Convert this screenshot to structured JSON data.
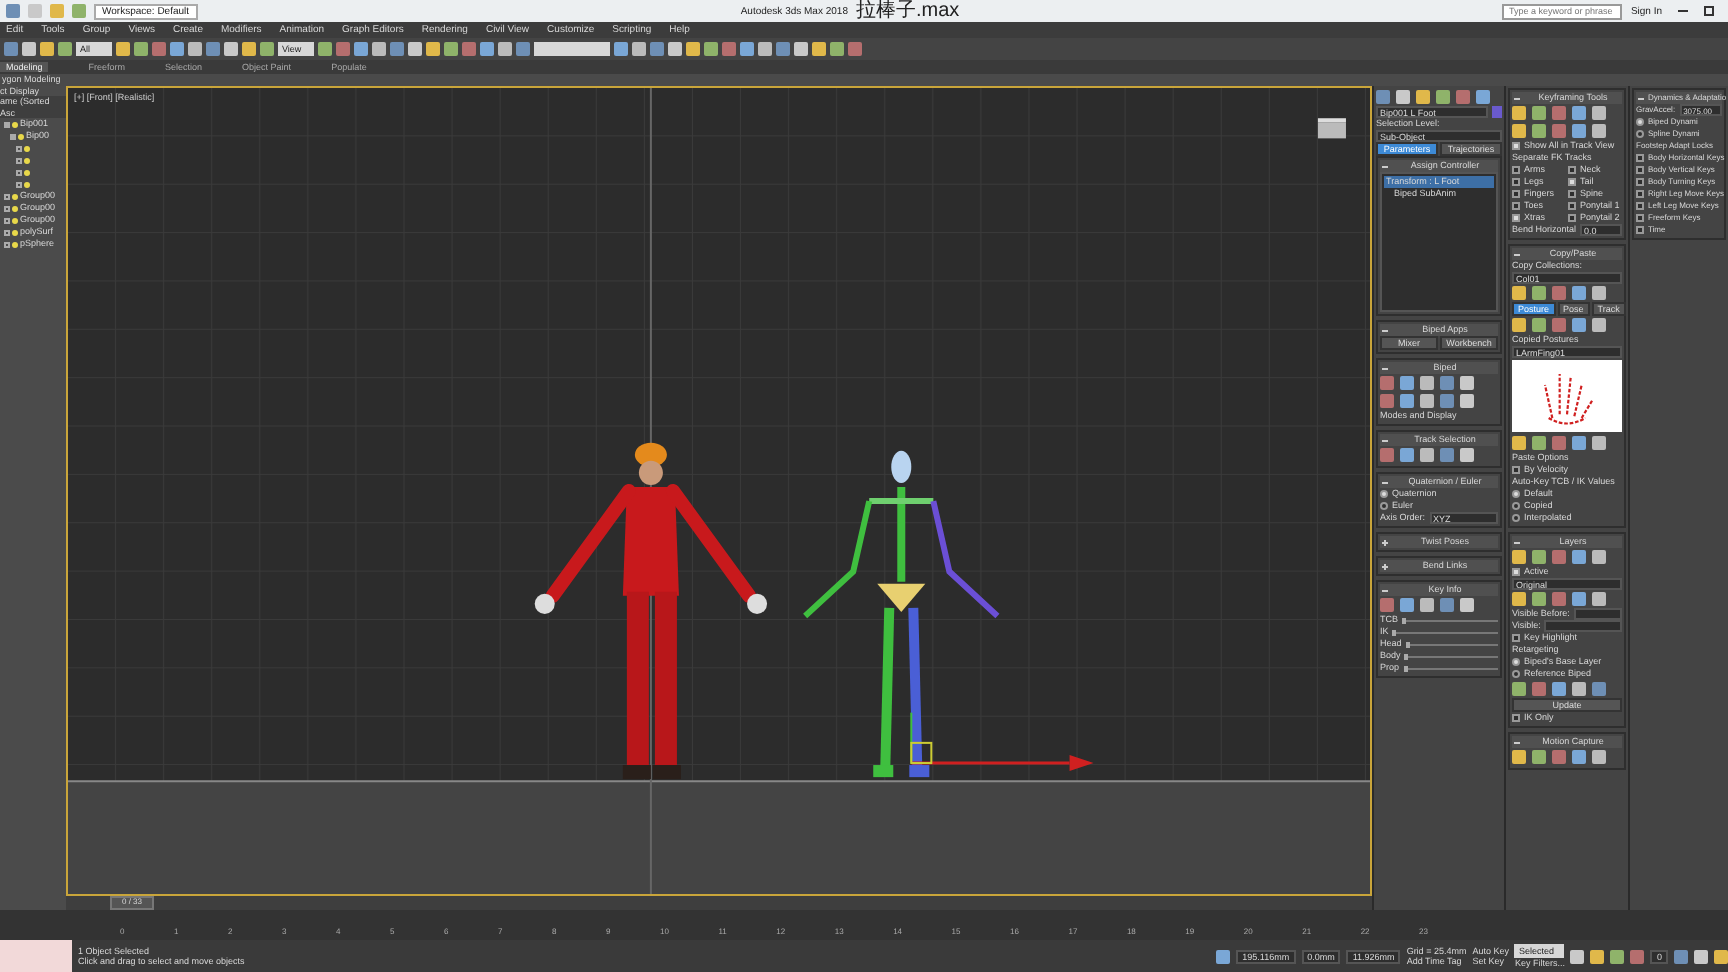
{
  "title_bar": {
    "workspace": "Workspace: Default",
    "title": "Autodesk 3ds Max 2018",
    "file": "拉棒子.max",
    "search": {
      "placeholder": "Type a keyword or phrase"
    },
    "sign_in": "Sign In"
  },
  "menu": [
    "Edit",
    "Tools",
    "Group",
    "Views",
    "Create",
    "Modifiers",
    "Animation",
    "Graph Editors",
    "Rendering",
    "Civil View",
    "Customize",
    "Scripting",
    "Help"
  ],
  "toolbar": {
    "selection_filter": "All",
    "reference_coordinate": "View"
  },
  "ribbon_tabs": [
    {
      "label": "Modeling",
      "selected": true
    },
    {
      "label": "Freeform",
      "selected": false
    },
    {
      "label": "Selection",
      "selected": false
    },
    {
      "label": "Object Paint",
      "selected": false
    },
    {
      "label": "Populate",
      "selected": false
    }
  ],
  "ribbon_panel": "ygon Modeling",
  "explorer": {
    "tabs": [
      "ct",
      "Display"
    ],
    "header": "ame (Sorted Asc",
    "items": [
      {
        "label": "Bip001",
        "expanded": true,
        "children": [
          {
            "label": "Bip00",
            "expanded": true,
            "children": [
              {
                "expanded": false
              },
              {
                "expanded": false
              },
              {
                "expanded": false
              },
              {
                "expanded": false
              }
            ]
          }
        ]
      },
      {
        "label": "Group00",
        "expanded": false
      },
      {
        "label": "Group00",
        "expanded": false
      },
      {
        "label": "Group00",
        "expanded": false
      },
      {
        "label": "polySurf",
        "expanded": false
      },
      {
        "label": "pSphere",
        "expanded": false
      }
    ]
  },
  "viewport": {
    "label": "[+] [Front] [Realistic]",
    "time_slider": "0 / 33",
    "level": 0
  },
  "timeline": [
    "0",
    "1",
    "2",
    "3",
    "4",
    "5",
    "6",
    "7",
    "8",
    "9",
    "10",
    "11",
    "12",
    "13",
    "14",
    "15",
    "16",
    "17",
    "18",
    "19",
    "20",
    "21",
    "22",
    "23"
  ],
  "command_panel": {
    "object_name": "Bip001 L Foot",
    "sections": [
      {
        "items": [
          {
            "kind": "label",
            "text": "Selection Level:"
          },
          {
            "kind": "field",
            "value": "Sub-Object"
          },
          {
            "kind": "buttons",
            "buttons": [
              {
                "label": "Parameters",
                "selected": true
              },
              {
                "label": "Trajectories",
                "selected": false
              }
            ]
          }
        ]
      },
      {
        "title": "Assign Controller",
        "expanded": true,
        "items": [
          {
            "kind": "tree",
            "nodes": [
              {
                "label": "Transform : L Foot",
                "selected": true,
                "children": [
                  {
                    "label": "Biped SubAnim",
                    "selected": false
                  }
                ]
              }
            ]
          }
        ]
      },
      {
        "title": "Biped Apps",
        "expanded": true,
        "items": [
          {
            "kind": "buttons",
            "buttons": [
              {
                "label": "Mixer",
                "selected": false
              },
              {
                "label": "Workbench",
                "selected": false
              }
            ]
          }
        ]
      },
      {
        "title": "Biped",
        "expanded": true,
        "items": [
          {
            "kind": "icons"
          },
          {
            "kind": "icons"
          },
          {
            "kind": "label",
            "text": "Modes and Display"
          }
        ]
      },
      {
        "title": "Track Selection",
        "expanded": true,
        "items": [
          {
            "kind": "icons"
          }
        ]
      },
      {
        "title": "Quaternion / Euler",
        "expanded": true,
        "items": [
          {
            "kind": "radio",
            "label": "Quaternion",
            "selected": true
          },
          {
            "kind": "radio",
            "label": "Euler",
            "selected": false
          },
          {
            "kind": "field",
            "label": "Axis Order:",
            "value": "XYZ"
          }
        ]
      },
      {
        "title": "Twist Poses",
        "expanded": false
      },
      {
        "title": "Bend Links",
        "expanded": false
      },
      {
        "title": "Key Info",
        "expanded": true,
        "items": [
          {
            "kind": "icons"
          },
          {
            "kind": "track",
            "label": "TCB",
            "level": 0
          },
          {
            "kind": "track",
            "label": "IK",
            "level": 0
          },
          {
            "kind": "track",
            "label": "Head",
            "level": 0
          },
          {
            "kind": "track",
            "label": "Body",
            "level": 0
          },
          {
            "kind": "track",
            "label": "Prop",
            "level": 0
          }
        ]
      }
    ]
  },
  "biped_panel": {
    "sections": [
      {
        "title": "Keyframing Tools",
        "expanded": true,
        "items": [
          {
            "kind": "icons"
          },
          {
            "kind": "icons"
          },
          {
            "kind": "check",
            "label": "Show All in Track View",
            "checked": true
          },
          {
            "kind": "label",
            "text": "Separate FK Tracks"
          },
          {
            "kind": "checks2",
            "checks": [
              {
                "label": "Arms",
                "checked": false
              },
              {
                "label": "Neck",
                "checked": false
              },
              {
                "label": "Legs",
                "checked": false
              },
              {
                "label": "Tail",
                "checked": true
              },
              {
                "label": "Fingers",
                "checked": false
              },
              {
                "label": "Spine",
                "checked": false
              },
              {
                "label": "Toes",
                "checked": false
              },
              {
                "label": "Ponytail 1",
                "checked": false
              },
              {
                "label": "Xtras",
                "checked": true
              },
              {
                "label": "Ponytail 2",
                "checked": false
              }
            ]
          },
          {
            "kind": "field",
            "label": "Bend Horizontal",
            "value": "0.0"
          }
        ]
      },
      {
        "title": "Copy/Paste",
        "expanded": true,
        "items": [
          {
            "kind": "label",
            "text": "Copy Collections:"
          },
          {
            "kind": "field",
            "value": "Col01"
          },
          {
            "kind": "icons"
          },
          {
            "kind": "buttons",
            "buttons": [
              {
                "label": "Posture",
                "selected": true
              },
              {
                "label": "Pose",
                "selected": false
              },
              {
                "label": "Track",
                "selected": false
              }
            ]
          },
          {
            "kind": "icons"
          },
          {
            "kind": "label",
            "text": "Copied Postures"
          },
          {
            "kind": "field",
            "value": "LArmFing01"
          },
          {
            "kind": "preview"
          },
          {
            "kind": "icons"
          },
          {
            "kind": "label",
            "text": "Paste Options"
          },
          {
            "kind": "check",
            "label": "By Velocity",
            "checked": false
          },
          {
            "kind": "label",
            "text": "Auto-Key TCB / IK Values"
          },
          {
            "kind": "radio",
            "label": "Default",
            "selected": true
          },
          {
            "kind": "radio",
            "label": "Copied",
            "selected": false
          },
          {
            "kind": "radio",
            "label": "Interpolated",
            "selected": false
          }
        ]
      },
      {
        "title": "Layers",
        "expanded": true,
        "items": [
          {
            "kind": "icons"
          },
          {
            "kind": "check",
            "label": "Active",
            "checked": true
          },
          {
            "kind": "field",
            "value": "Original"
          },
          {
            "kind": "icons"
          },
          {
            "kind": "field",
            "label": "Visible Before:"
          },
          {
            "kind": "field",
            "label": "Visible:"
          },
          {
            "kind": "check",
            "label": "Key Highlight",
            "checked": false
          },
          {
            "kind": "label",
            "text": "Retargeting"
          },
          {
            "kind": "radio",
            "label": "Biped's Base Layer",
            "selected": true
          },
          {
            "kind": "radio",
            "label": "Reference Biped",
            "selected": false
          },
          {
            "kind": "icons"
          },
          {
            "kind": "buttons",
            "buttons": [
              {
                "label": "Update",
                "selected": false
              }
            ]
          },
          {
            "kind": "check",
            "label": "IK Only",
            "checked": false
          }
        ]
      },
      {
        "title": "Motion Capture",
        "expanded": true,
        "items": [
          {
            "kind": "icons"
          }
        ]
      }
    ]
  },
  "dynamics_panel": {
    "sections": [
      {
        "title": "Dynamics & Adaptatio",
        "expanded": true,
        "items": [
          {
            "kind": "field",
            "label": "GravAccel:",
            "value": "3075.00"
          },
          {
            "kind": "radio",
            "label": "Biped Dynami",
            "selected": true
          },
          {
            "kind": "radio",
            "label": "Spline Dynami",
            "selected": false
          },
          {
            "kind": "label",
            "text": "Footstep Adapt Locks"
          },
          {
            "kind": "check",
            "label": "Body Horizontal Keys",
            "checked": false
          },
          {
            "kind": "check",
            "label": "Body Vertical Keys",
            "checked": false
          },
          {
            "kind": "check",
            "label": "Body Turning Keys",
            "checked": false
          },
          {
            "kind": "check",
            "label": "Right Leg Move Keys",
            "checked": false
          },
          {
            "kind": "check",
            "label": "Left Leg Move Keys",
            "checked": false
          },
          {
            "kind": "check",
            "label": "Freeform Keys",
            "checked": false
          },
          {
            "kind": "check",
            "label": "Time",
            "checked": false
          }
        ]
      }
    ]
  },
  "status_bar": {
    "selection": "1 Object Selected",
    "prompt": "Click and drag to select and move objects",
    "x": "195.116mm",
    "y": "0.0mm",
    "z": "11.926mm",
    "grid": "Grid = 25.4mm",
    "time_tag": "Add Time Tag",
    "auto_key": "Auto Key",
    "key_mode": "Selected",
    "set_key": "Set Key",
    "key_filters": "Key Filters...",
    "frame": "0"
  }
}
